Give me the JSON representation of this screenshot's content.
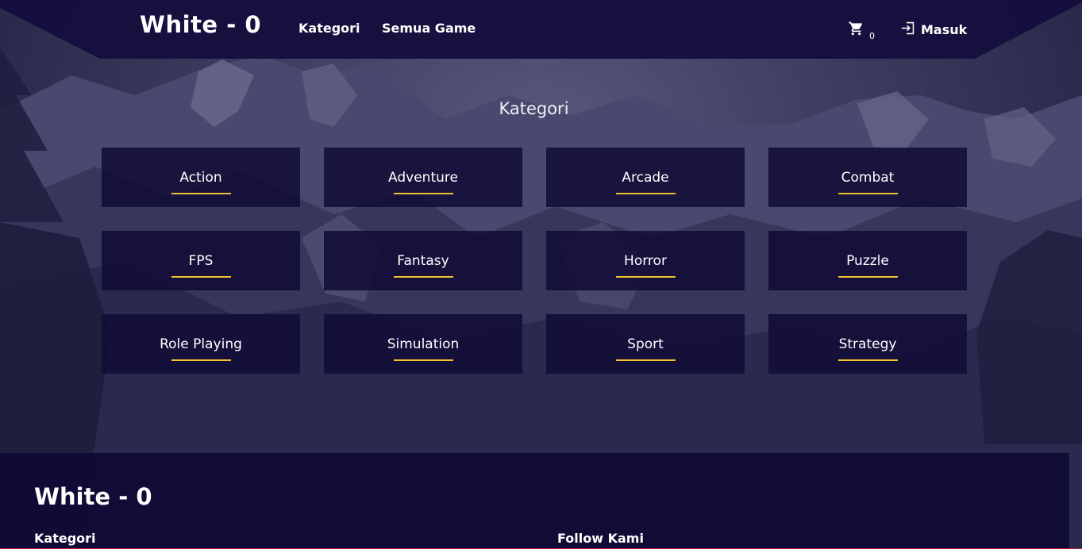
{
  "header": {
    "brand": "White - 0",
    "nav": [
      {
        "label": "Kategori"
      },
      {
        "label": "Semua Game"
      }
    ],
    "cart": {
      "icon": "cart-icon",
      "count": "0"
    },
    "login": {
      "icon": "login-icon",
      "label": "Masuk"
    }
  },
  "main": {
    "title": "Kategori",
    "categories": [
      {
        "label": "Action"
      },
      {
        "label": "Adventure"
      },
      {
        "label": "Arcade"
      },
      {
        "label": "Combat"
      },
      {
        "label": "FPS"
      },
      {
        "label": "Fantasy"
      },
      {
        "label": "Horror"
      },
      {
        "label": "Puzzle"
      },
      {
        "label": "Role Playing"
      },
      {
        "label": "Simulation"
      },
      {
        "label": "Sport"
      },
      {
        "label": "Strategy"
      }
    ]
  },
  "footer": {
    "brand": "White - 0",
    "headings": [
      {
        "label": "Kategori"
      },
      {
        "label": "Follow Kami"
      }
    ]
  },
  "colors": {
    "navy": "#110c37",
    "accent": "#f2c12e",
    "text": "#ffffff"
  }
}
